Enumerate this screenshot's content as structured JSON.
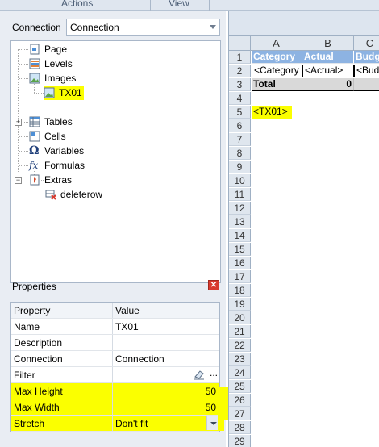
{
  "ribbon": {
    "tab_actions": "Actions",
    "tab_view": "View"
  },
  "connection": {
    "label": "Connection",
    "value": "Connection"
  },
  "tree": {
    "items": [
      {
        "label": "Page",
        "icon": "page-icon"
      },
      {
        "label": "Levels",
        "icon": "levels-icon"
      },
      {
        "label": "Images",
        "icon": "images-icon"
      },
      {
        "label": "TX01",
        "icon": "image-icon",
        "selected": true
      },
      {
        "label": "Tables",
        "icon": "tables-icon"
      },
      {
        "label": "Cells",
        "icon": "cells-icon"
      },
      {
        "label": "Variables",
        "icon": "variables-icon"
      },
      {
        "label": "Formulas",
        "icon": "formulas-icon"
      },
      {
        "label": "Extras",
        "icon": "extras-icon"
      },
      {
        "label": "deleterow",
        "icon": "delete-row-icon"
      }
    ]
  },
  "properties": {
    "title": "Properties",
    "col_property": "Property",
    "col_value": "Value",
    "rows": [
      {
        "name": "Name",
        "value": "TX01"
      },
      {
        "name": "Description",
        "value": ""
      },
      {
        "name": "Connection",
        "value": "Connection"
      },
      {
        "name": "Filter",
        "value": "",
        "ellipsis": "..."
      },
      {
        "name": "Max Height",
        "value": "50"
      },
      {
        "name": "Max Width",
        "value": "50"
      },
      {
        "name": "Stretch",
        "value": "Don't fit"
      }
    ]
  },
  "sheet": {
    "columns": [
      "A",
      "B",
      "C"
    ],
    "rows": [
      "1",
      "2",
      "3",
      "4",
      "5",
      "6",
      "7",
      "8",
      "9",
      "10",
      "11",
      "12",
      "13",
      "14",
      "15",
      "16",
      "17",
      "18",
      "19",
      "20",
      "21",
      "22",
      "23",
      "24",
      "25",
      "26",
      "27",
      "28",
      "29"
    ],
    "r1": [
      "Category",
      "Actual",
      "Budg"
    ],
    "r2": [
      "<Category",
      "<Actual>",
      "<Bud"
    ],
    "r3": [
      "Total",
      "0",
      ""
    ],
    "r5": "<TX01>"
  },
  "colors": {
    "header_fill": "#8db3e2",
    "highlight": "#fbff00",
    "close_button": "#d83a2e"
  }
}
